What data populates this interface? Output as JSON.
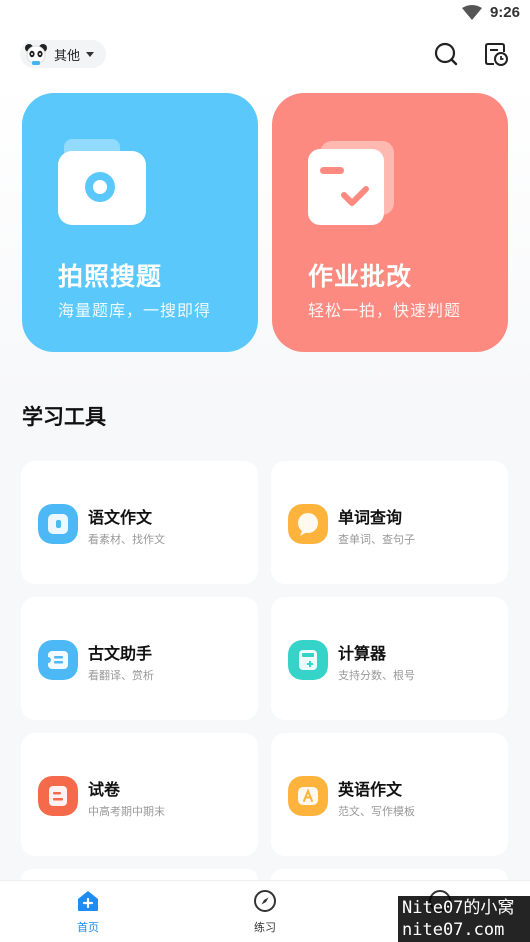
{
  "status_bar": {
    "time": "9:26"
  },
  "header": {
    "grade": "其他"
  },
  "feature_cards": [
    {
      "title": "拍照搜题",
      "subtitle": "海量题库，一搜即得",
      "color": "#5ac8fb"
    },
    {
      "title": "作业批改",
      "subtitle": "轻松一拍，快速判题",
      "color": "#fd8a80"
    }
  ],
  "tools_section": {
    "title": "学习工具",
    "items": [
      {
        "name": "语文作文",
        "desc": "看素材、找作文",
        "icon": "book-icon",
        "color": "#4cb8f5"
      },
      {
        "name": "单词查询",
        "desc": "查单词、查句子",
        "icon": "chat-bubble-icon",
        "color": "#fdb33c"
      },
      {
        "name": "古文助手",
        "desc": "看翻译、赏析",
        "icon": "scroll-icon",
        "color": "#4cb8f5"
      },
      {
        "name": "计算器",
        "desc": "支持分数、根号",
        "icon": "calculator-icon",
        "color": "#35d3c8"
      },
      {
        "name": "试卷",
        "desc": "中高考期中期末",
        "icon": "exam-paper-icon",
        "color": "#f56a4a"
      },
      {
        "name": "英语作文",
        "desc": "范文、写作模板",
        "icon": "english-letter-icon",
        "color": "#fdb33c"
      }
    ]
  },
  "bottom_nav": {
    "items": [
      {
        "label": "首页",
        "icon": "home-icon",
        "active": true
      },
      {
        "label": "练习",
        "icon": "compass-icon",
        "active": false
      }
    ],
    "active_color": "#1e8cf0"
  },
  "watermark": {
    "line1": "Nite07的小窝",
    "line2": "nite07.com"
  }
}
